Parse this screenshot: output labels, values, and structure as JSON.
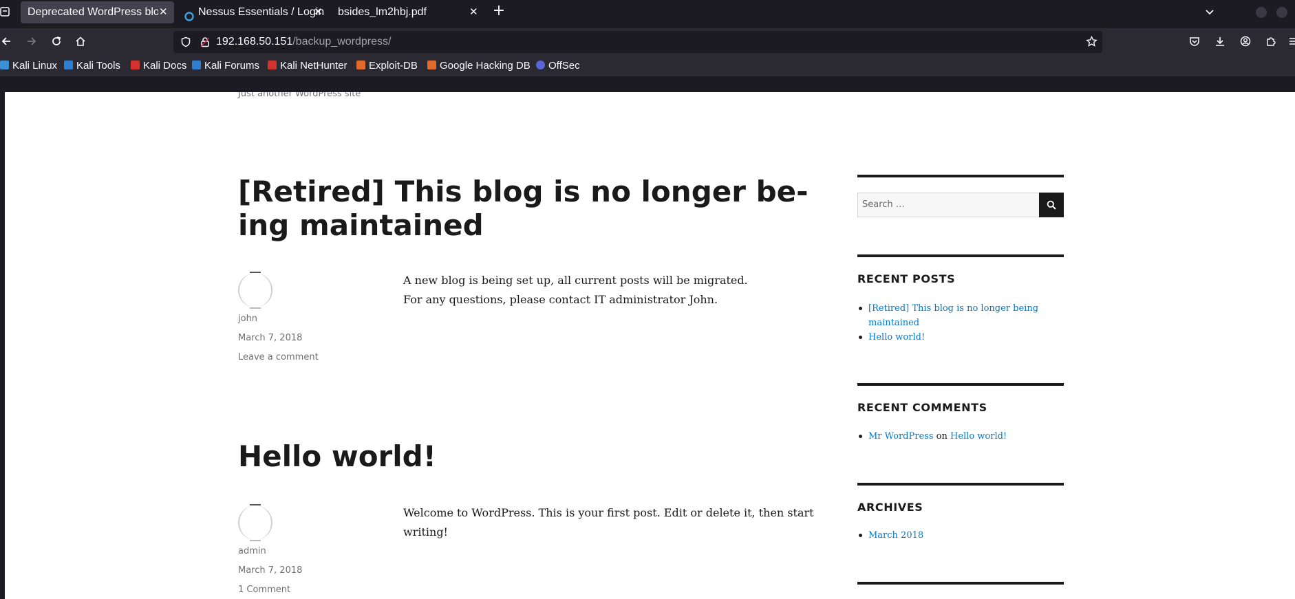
{
  "browser": {
    "tabs": [
      {
        "title": "Deprecated WordPress blog",
        "close": "✕"
      },
      {
        "title": "Nessus Essentials / Login",
        "close": "✕"
      },
      {
        "title": "bsides_lm2hbj.pdf",
        "close": "✕"
      }
    ],
    "new_tab": "+",
    "url_host": "192.168.50.151",
    "url_path": "/backup_wordpress/",
    "bookmarks": [
      {
        "label": "Kali Linux",
        "color": "#3f8fd6"
      },
      {
        "label": "Kali Tools",
        "color": "#2f7fd0"
      },
      {
        "label": "Kali Docs",
        "color": "#d1332e"
      },
      {
        "label": "Kali Forums",
        "color": "#2f7fd0"
      },
      {
        "label": "Kali NetHunter",
        "color": "#d1332e"
      },
      {
        "label": "Exploit-DB",
        "color": "#e06a2b"
      },
      {
        "label": "Google Hacking DB",
        "color": "#e06a2b"
      },
      {
        "label": "OffSec",
        "color": "#5a66d8"
      }
    ]
  },
  "site": {
    "tagline": "Just another WordPress site"
  },
  "posts": [
    {
      "title_line1": "[Retired] This blog is no longer be-",
      "title_line2": "ing maintained",
      "author": "john",
      "date": "March 7, 2018",
      "comment_link": "Leave a comment",
      "body_line1": "A new blog is being set up, all current posts will be migrated.",
      "body_line2": "For any questions, please contact IT administrator John."
    },
    {
      "title_line1": "Hello world!",
      "author": "admin",
      "date": "March 7, 2018",
      "comment_link": "1 Comment",
      "body_line1": "Welcome to WordPress. This is your first post. Edit or delete it, then start",
      "body_line2": "writing!"
    }
  ],
  "sidebar": {
    "search_placeholder": "Search …",
    "recent_posts_title": "RECENT POSTS",
    "recent_posts": [
      "[Retired] This blog is no longer being maintained",
      "Hello world!"
    ],
    "recent_comments_title": "RECENT COMMENTS",
    "recent_comment": {
      "author": "Mr WordPress",
      "on": "on",
      "post": "Hello world!"
    },
    "archives_title": "ARCHIVES",
    "archives": [
      "March 2018"
    ]
  },
  "colors": {
    "link": "#007acc",
    "chrome_dark": "#1c1b22",
    "chrome_mid": "#2b2a33"
  }
}
